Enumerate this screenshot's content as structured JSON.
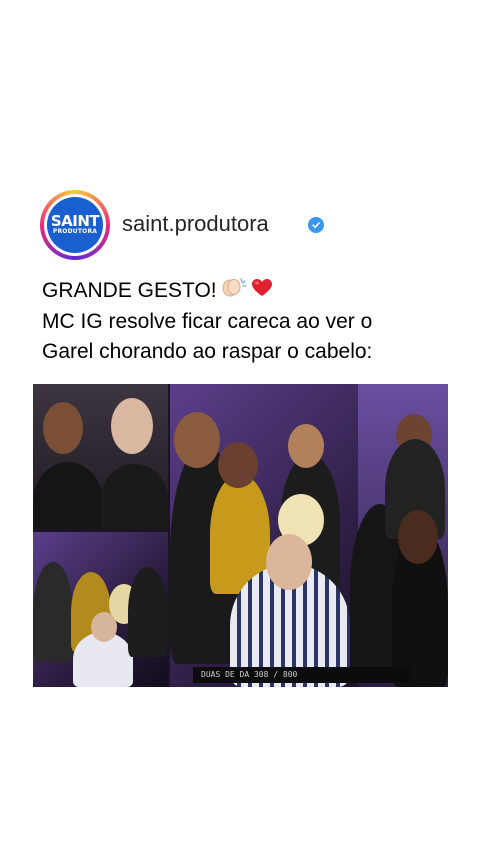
{
  "post": {
    "avatar_text_top": "SAINT",
    "avatar_text_bottom": "PRODUTORA",
    "username": "saint.produtora",
    "verified_icon": "verified-badge-icon",
    "caption_lines": [
      "GRANDE GESTO!",
      "MC IG resolve ficar careca ao ver o",
      "Garel chorando ao raspar o cabelo:"
    ],
    "caption_emojis": [
      "clapping-hands-icon",
      "sparkles-icon",
      "red-heart-icon"
    ],
    "photo_overlay_text": "DUAS DE DA 308 / 800"
  },
  "colors": {
    "verified": "#3897f0",
    "avatar_bg": "#1a5fd0",
    "text": "#000000"
  }
}
